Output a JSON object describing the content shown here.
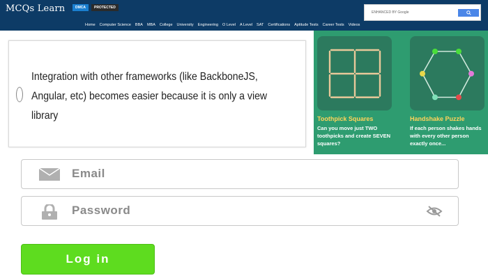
{
  "header": {
    "logo": "MCQs Learn",
    "badge_dmca": "DMCA",
    "badge_protected": "PROTECTED",
    "search_placeholder": "ENHANCED BY Google",
    "nav": [
      "Home",
      "Computer Science",
      "BBA",
      "MBA",
      "College",
      "University",
      "Engineering",
      "O Level",
      "A Level",
      "SAT",
      "Certifications",
      "Aptitude Tests",
      "Career Tests",
      "Videos"
    ]
  },
  "question": {
    "text": "Integration with other frameworks (like BackboneJS, Angular, etc) becomes easier because it is only a view library"
  },
  "ads": {
    "toothpick": {
      "title": "Toothpick Squares",
      "desc": "Can you move just TWO toothpicks and create SEVEN squares?"
    },
    "handshake": {
      "title": "Handshake Puzzle",
      "desc": "If each person shakes hands with every other person exactly once..."
    }
  },
  "form": {
    "email_placeholder": "Email",
    "password_placeholder": "Password",
    "login_label": "Log in"
  },
  "colors": {
    "header_bg": "#0d3b66",
    "ad_bg": "#2e9c70",
    "login_bg": "#5edc1f"
  }
}
